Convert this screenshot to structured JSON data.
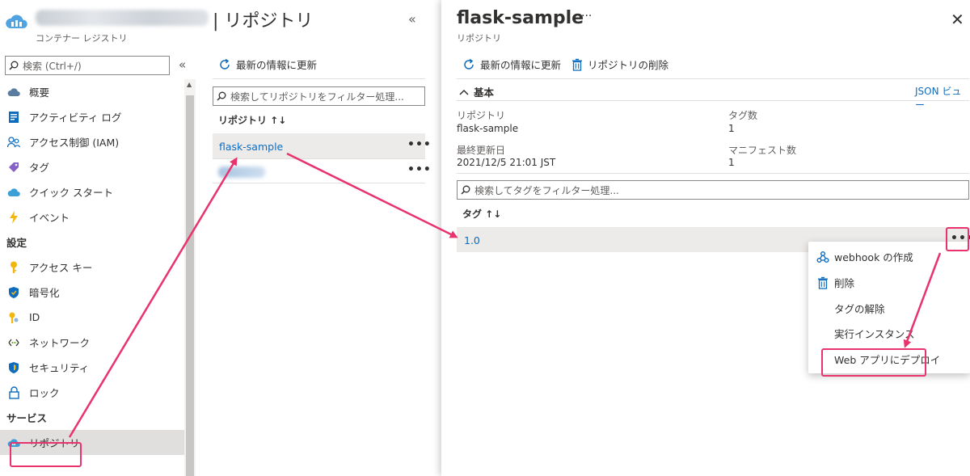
{
  "registry": {
    "title": "| リポジトリ",
    "subtitle": "コンテナー レジストリ",
    "collapse_glyph": "«",
    "search_placeholder": "検索 (Ctrl+/)",
    "nav": {
      "items_top": [
        {
          "label": "概要",
          "icon": "cloud-icon"
        },
        {
          "label": "アクティビティ ログ",
          "icon": "activity-log-icon"
        },
        {
          "label": "アクセス制御 (IAM)",
          "icon": "people-icon"
        },
        {
          "label": "タグ",
          "icon": "tag-icon"
        },
        {
          "label": "クイック スタート",
          "icon": "cloud-quickstart-icon"
        },
        {
          "label": "イベント",
          "icon": "lightning-icon"
        }
      ],
      "section_settings": "設定",
      "items_settings": [
        {
          "label": "アクセス キー",
          "icon": "key-icon"
        },
        {
          "label": "暗号化",
          "icon": "shield-icon"
        },
        {
          "label": "ID",
          "icon": "identity-key-icon"
        },
        {
          "label": "ネットワーク",
          "icon": "network-icon"
        },
        {
          "label": "セキュリティ",
          "icon": "security-shield-icon"
        },
        {
          "label": "ロック",
          "icon": "lock-icon"
        }
      ],
      "section_services": "サービス",
      "items_services": [
        {
          "label": "リポジトリ",
          "icon": "repository-icon",
          "selected": true
        }
      ]
    }
  },
  "repo_list": {
    "refresh_label": "最新の情報に更新",
    "search_placeholder": "検索してリポジトリをフィルター処理...",
    "column_header": "リポジトリ ↑↓",
    "rows": [
      {
        "name": "flask-sample",
        "more": "•••"
      },
      {
        "name": "",
        "more": "•••"
      }
    ]
  },
  "repo_detail": {
    "title": "flask-sample",
    "title_more": "···",
    "subtitle": "リポジトリ",
    "close": "✕",
    "refresh_label": "最新の情報に更新",
    "delete_label": "リポジトリの削除",
    "essentials_label": "基本",
    "json_view": "JSON ビュー",
    "props": {
      "repository_label": "リポジトリ",
      "repository_value": "flask-sample",
      "tag_count_label": "タグ数",
      "tag_count_value": "1",
      "last_updated_label": "最終更新日",
      "last_updated_value": "2021/12/5 21:01 JST",
      "manifest_count_label": "マニフェスト数",
      "manifest_count_value": "1"
    },
    "tag_search_placeholder": "検索してタグをフィルター処理...",
    "tag_column_header": "タグ ↑↓",
    "tags": [
      {
        "name": "1.0",
        "more": "•••"
      }
    ],
    "context_menu": [
      {
        "label": "webhook の作成",
        "icon": "webhook-icon"
      },
      {
        "label": "削除",
        "icon": "trash-icon"
      },
      {
        "label": "タグの解除",
        "icon": ""
      },
      {
        "label": "実行インスタンス",
        "icon": ""
      },
      {
        "label": "Web アプリにデプロイ",
        "icon": ""
      }
    ]
  },
  "colors": {
    "link": "#0f6cbd",
    "annotation": "#e8336d",
    "selected_row": "#edebe9"
  }
}
